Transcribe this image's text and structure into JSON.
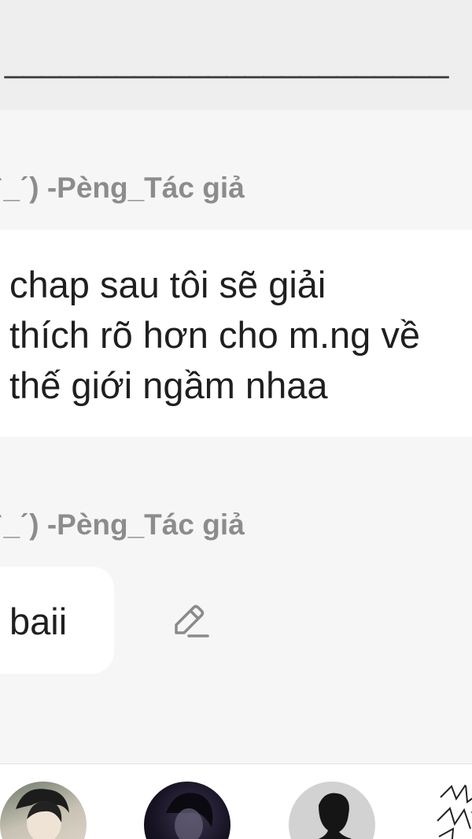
{
  "top": {
    "divider_text": "________________________"
  },
  "thread": {
    "author_label_1": "ˋ_ˊ) -Pèng_Tác giả",
    "message_lines": [
      "chap sau tôi sẽ giải",
      "thích rõ hơn cho m.ng về",
      "thế giới ngầm nhaa"
    ],
    "author_label_2": "ˋ_ˊ) -Pèng_Tác giả",
    "reply_text": "baii"
  },
  "icons": {
    "edit": "pencil-edit-icon"
  },
  "colors": {
    "background": "#f6f6f6",
    "top_band": "#eeeeee",
    "card": "#ffffff",
    "author_gray": "#8c8c8c",
    "text_dark": "#1f1f1f"
  }
}
